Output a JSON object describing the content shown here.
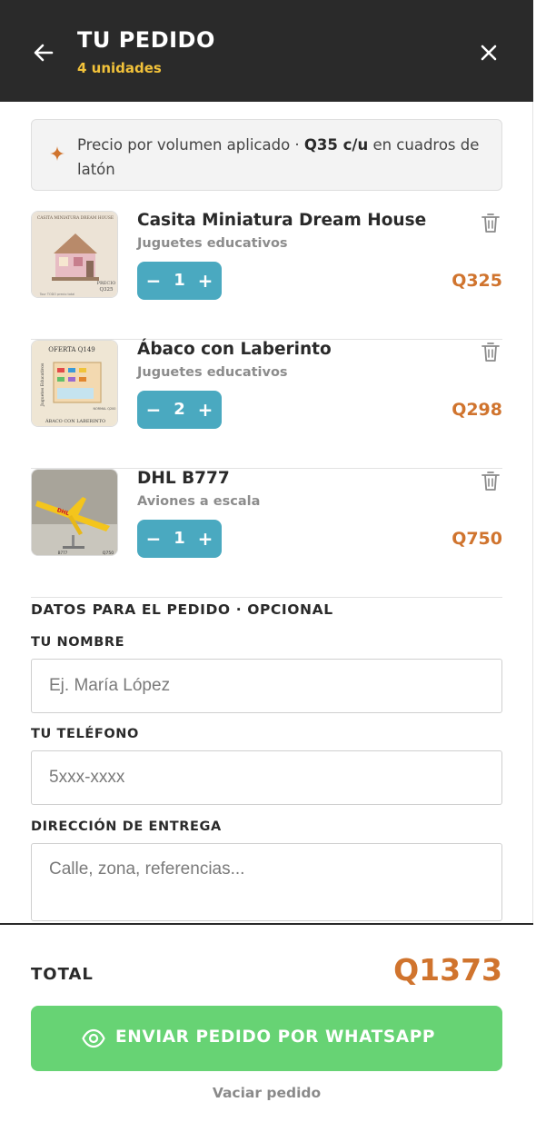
{
  "header": {
    "title": "TU PEDIDO",
    "subtitle": "4 unidades",
    "back_icon": "arrow-left-icon",
    "close_icon": "close-icon"
  },
  "notice": {
    "icon": "sparkle-icon",
    "text_before": "Precio por volumen aplicado · ",
    "highlight": "Q35 c/u",
    "text_after": " en cuadros de latón"
  },
  "items": [
    {
      "name": "Casita Miniatura Dream House",
      "category": "Juguetes educativos",
      "qty": "1",
      "price": "Q325"
    },
    {
      "name": "Ábaco con Laberinto",
      "category": "Juguetes educativos",
      "qty": "2",
      "price": "Q298"
    },
    {
      "name": "DHL B777",
      "category": "Aviones a escala",
      "qty": "1",
      "price": "Q750"
    }
  ],
  "stepper": {
    "minus": "−",
    "plus": "+"
  },
  "thumbs": {
    "house": {
      "top": "CASITA MINIATURA DREAM HOUSE",
      "price_label": "PRECIO",
      "price": "Q325",
      "bottom": "Tour TODO precio total"
    },
    "abacus": {
      "top": "OFERTA Q149",
      "side": "Juguetes Educativos",
      "normal": "NORMAL Q200",
      "bottom": "ÁBACO CON LABERINTO"
    },
    "plane": {
      "brand": "DHL",
      "model": "B777",
      "price": "Q750"
    }
  },
  "form": {
    "title": "DATOS PARA EL PEDIDO · OPCIONAL",
    "name_label": "TU NOMBRE",
    "name_placeholder": "Ej. María López",
    "phone_label": "TU TELÉFONO",
    "phone_placeholder": "5xxx-xxxx",
    "address_label": "DIRECCIÓN DE ENTREGA",
    "address_placeholder": "Calle, zona, referencias..."
  },
  "footer": {
    "total_label": "TOTAL",
    "total_value": "Q1373",
    "send_label": "ENVIAR PEDIDO POR WHATSAPP",
    "send_icon": "eye-icon",
    "clear_label": "Vaciar pedido"
  },
  "colors": {
    "header_bg": "#2a2a2a",
    "subtitle": "#f2c23a",
    "accent_price": "#d0742e",
    "stepper": "#4aa9c0",
    "whatsapp": "#67d374"
  }
}
